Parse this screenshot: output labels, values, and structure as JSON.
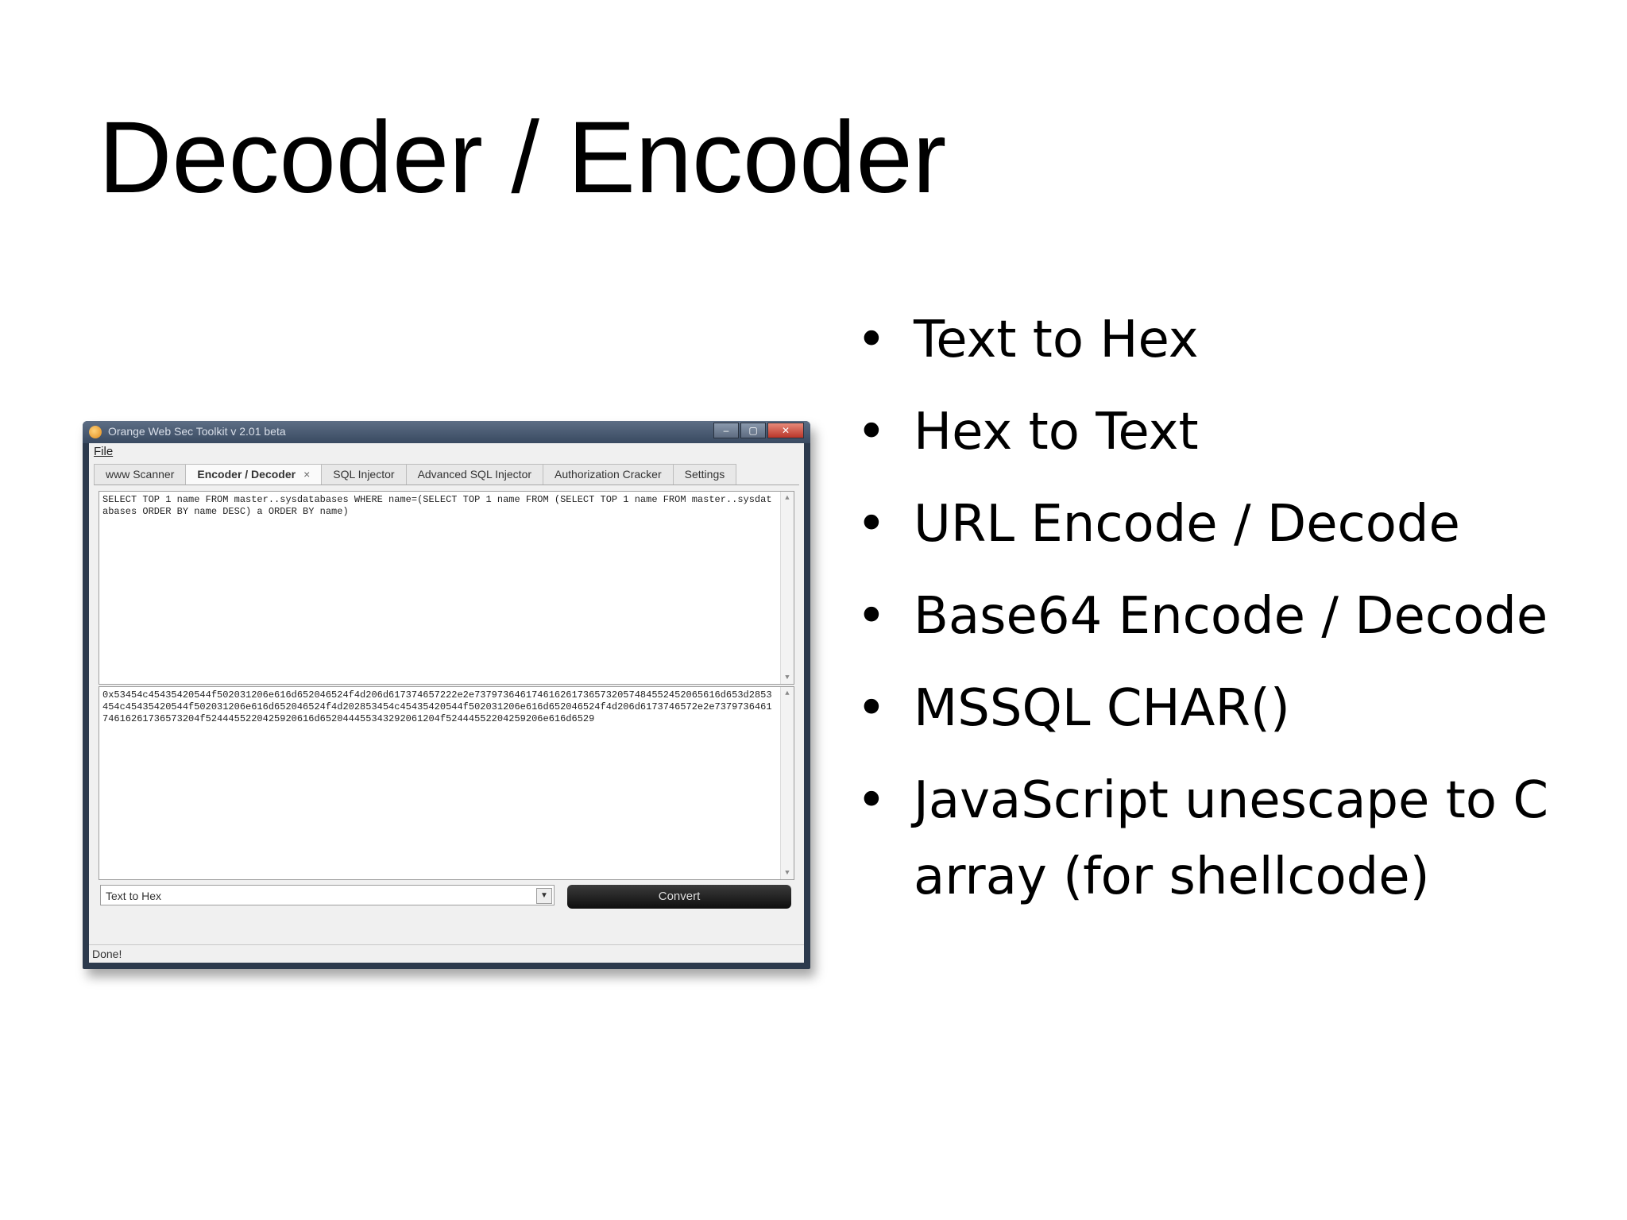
{
  "slide": {
    "title": "Decoder / Encoder",
    "bullet_char": "•",
    "bullets": [
      "Text to Hex",
      "Hex to Text",
      "URL Encode / Decode",
      "Base64 Encode / Decode",
      "MSSQL CHAR()",
      "JavaScript unescape to C array (for shellcode)"
    ]
  },
  "window": {
    "title": "Orange Web Sec Toolkit v 2.01 beta",
    "controls": {
      "minimize": "–",
      "maximize": "▢",
      "close": "✕"
    },
    "menu": {
      "file": "File"
    },
    "tabs": [
      {
        "label": "www Scanner"
      },
      {
        "label": "Encoder / Decoder",
        "close": "×"
      },
      {
        "label": "SQL Injector"
      },
      {
        "label": "Advanced SQL Injector"
      },
      {
        "label": "Authorization Cracker"
      },
      {
        "label": "Settings"
      }
    ],
    "input_text": "SELECT TOP 1 name FROM master..sysdatabases WHERE name=(SELECT TOP 1 name FROM (SELECT TOP 1 name FROM master..sysdatabases ORDER BY name DESC) a ORDER BY name)",
    "output_text": "0x53454c45435420544f502031206e616d652046524f4d206d617374657222e2e7379736461746162617365732057484552452065616d653d2853454c45435420544f502031206e616d652046524f4d202853454c45435420544f502031206e616d652046524f4d206d6173746572e2e737973646174616261736573204f5244455220425920616d652044455343292061204f52444552204259206e616d6529",
    "mode_select": "Text to Hex",
    "convert_label": "Convert",
    "status": "Done!",
    "scroll_up": "▲",
    "scroll_down": "▼",
    "select_arrow": "▼"
  }
}
